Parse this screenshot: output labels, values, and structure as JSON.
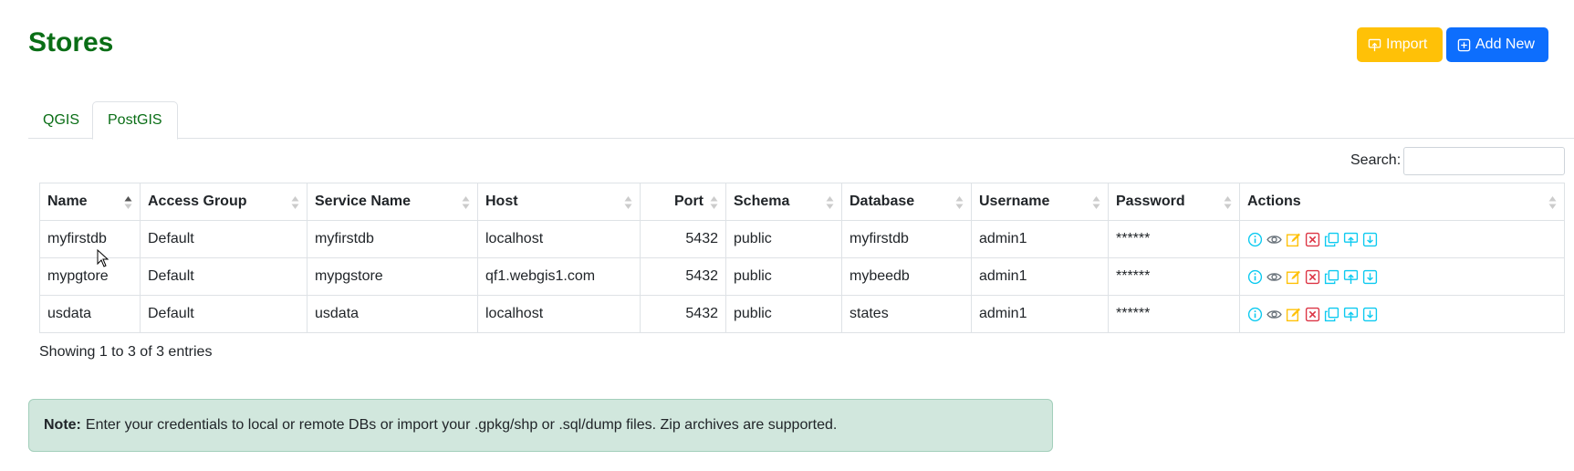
{
  "page": {
    "title": "Stores"
  },
  "toolbar": {
    "import_label": "Import",
    "add_new_label": "Add New"
  },
  "tabs": [
    {
      "label": "QGIS",
      "active": false
    },
    {
      "label": "PostGIS",
      "active": true
    }
  ],
  "search": {
    "label": "Search:",
    "value": "",
    "placeholder": ""
  },
  "table": {
    "columns": [
      "Name",
      "Access Group",
      "Service Name",
      "Host",
      "Port",
      "Schema",
      "Database",
      "Username",
      "Password",
      "Actions"
    ],
    "sorted_column": "Name",
    "rows": [
      {
        "name": "myfirstdb",
        "access_group": "Default",
        "service_name": "myfirstdb",
        "host": "localhost",
        "port": "5432",
        "schema": "public",
        "database": "myfirstdb",
        "username": "admin1",
        "password": "******"
      },
      {
        "name": "mypgtore",
        "access_group": "Default",
        "service_name": "mypgstore",
        "host": "qf1.webgis1.com",
        "port": "5432",
        "schema": "public",
        "database": "mybeedb",
        "username": "admin1",
        "password": "******"
      },
      {
        "name": "usdata",
        "access_group": "Default",
        "service_name": "usdata",
        "host": "localhost",
        "port": "5432",
        "schema": "public",
        "database": "states",
        "username": "admin1",
        "password": "******"
      }
    ],
    "action_icons": [
      "info-icon",
      "eye-icon",
      "edit-icon",
      "delete-icon",
      "copy-icon",
      "upload-icon",
      "download-icon"
    ]
  },
  "footer": {
    "info": "Showing 1 to 3 of 3 entries"
  },
  "note": {
    "label": "Note:",
    "text": "Enter your credentials to local or remote DBs or import your .gpkg/shp or .sql/dump files. Zip archives are supported."
  },
  "colors": {
    "title_green": "#0a6e16",
    "import_yellow": "#ffc107",
    "add_blue": "#0d6efd",
    "note_bg": "#d1e7dd",
    "action_cyan": "#0dcaf0",
    "action_edit": "#ffc107",
    "action_delete": "#dc3545",
    "action_view": "#6c757d"
  }
}
